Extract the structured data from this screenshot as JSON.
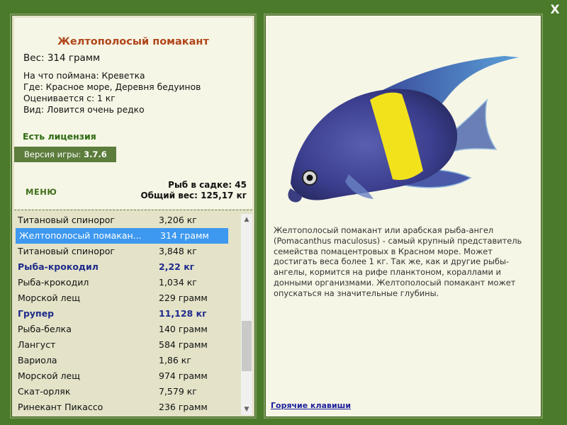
{
  "window": {
    "close_label": "X"
  },
  "fish": {
    "title": "Желтополосый помакант",
    "weight_line": "Вес: 314 грамм",
    "details": [
      "На что поймана: Креветка",
      "Где: Красное море, Деревня бедуинов",
      "Оценивается с: 1 кг",
      "Вид: Ловится очень редко"
    ],
    "description": "Желтополосый помакант или арабская рыба-ангел (Pomacanthus maculosus) - самый крупный представитель семейства помацентровых в Красном море. Может достигать веса более 1 кг. Так же, как и другие рыбы-ангелы, кормится на рифе планктоном, кораллами и донными организмами. Желтополосый помакант может опускаться на значительные глубины."
  },
  "license": "Есть лицензия",
  "version": {
    "label": "Версия игры:",
    "value": "3.7.6"
  },
  "menu_label": "МЕНЮ",
  "keepnet": {
    "count_line": "Рыб в садке: 45",
    "total_line": "Общий вес: 125,17 кг"
  },
  "catch_list": [
    {
      "name": "Титановый спинорог",
      "weight": "3,206 кг",
      "bold": false,
      "selected": false
    },
    {
      "name": "Желтополосый помакан...",
      "weight": "314 грамм",
      "bold": false,
      "selected": true
    },
    {
      "name": "Титановый спинорог",
      "weight": "3,848 кг",
      "bold": false,
      "selected": false
    },
    {
      "name": "Рыба-крокодил",
      "weight": "2,22 кг",
      "bold": true,
      "selected": false
    },
    {
      "name": "Рыба-крокодил",
      "weight": "1,034 кг",
      "bold": false,
      "selected": false
    },
    {
      "name": "Морской лещ",
      "weight": "229 грамм",
      "bold": false,
      "selected": false
    },
    {
      "name": "Групер",
      "weight": "11,128 кг",
      "bold": true,
      "selected": false
    },
    {
      "name": "Рыба-белка",
      "weight": "140 грамм",
      "bold": false,
      "selected": false
    },
    {
      "name": "Лангуст",
      "weight": "584 грамм",
      "bold": false,
      "selected": false
    },
    {
      "name": "Вариола",
      "weight": "1,86 кг",
      "bold": false,
      "selected": false
    },
    {
      "name": "Морской лещ",
      "weight": "974 грамм",
      "bold": false,
      "selected": false
    },
    {
      "name": "Скат-орляк",
      "weight": "7,579 кг",
      "bold": false,
      "selected": false
    },
    {
      "name": "Ринекант Пикассо",
      "weight": "236 грамм",
      "bold": false,
      "selected": false
    }
  ],
  "hotkeys_label": "Горячие клавиши",
  "colors": {
    "background": "#4b7a2a",
    "selection": "#3d98f0",
    "title": "#b0451a",
    "license": "#2e6b12",
    "bold_entry": "#1f2b8c"
  }
}
